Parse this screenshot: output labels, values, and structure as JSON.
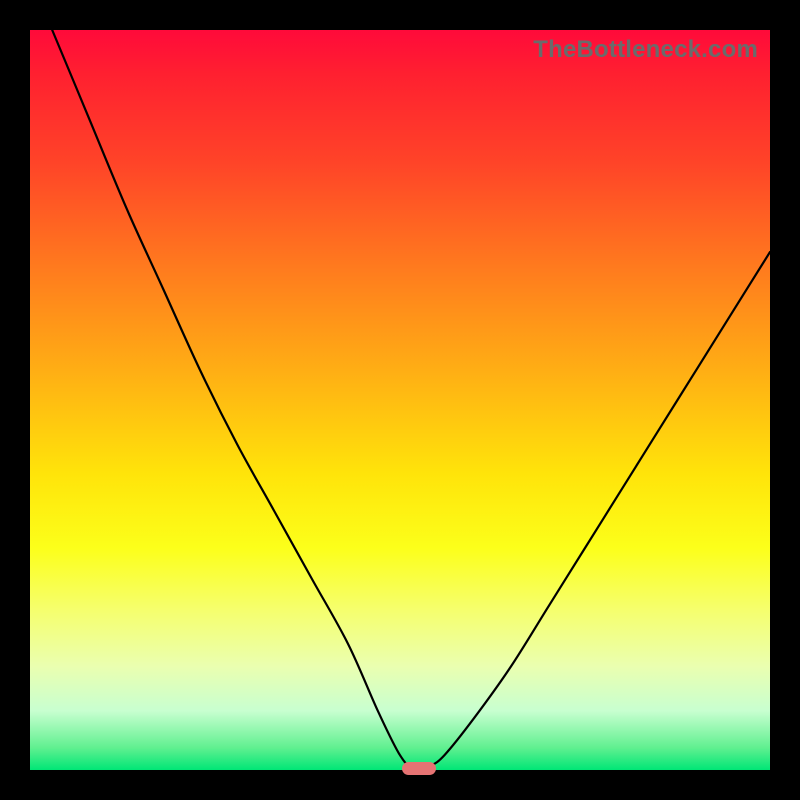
{
  "watermark": "TheBottleneck.com",
  "chart_data": {
    "type": "line",
    "title": "",
    "xlabel": "",
    "ylabel": "",
    "xlim": [
      0,
      100
    ],
    "ylim": [
      0,
      100
    ],
    "grid": false,
    "legend": false,
    "series": [
      {
        "name": "curve",
        "x": [
          3,
          8,
          13,
          18,
          23,
          28,
          33,
          38,
          43,
          47,
          50,
          52,
          54,
          56,
          60,
          65,
          70,
          75,
          80,
          85,
          90,
          95,
          100
        ],
        "y": [
          100,
          88,
          76,
          65,
          54,
          44,
          35,
          26,
          17,
          8,
          2,
          0,
          0.5,
          2,
          7,
          14,
          22,
          30,
          38,
          46,
          54,
          62,
          70
        ]
      }
    ],
    "marker": {
      "x": 52.5,
      "y": 0,
      "color": "#e57373"
    },
    "background_gradient": [
      "#ff0a3a",
      "#ffe40a",
      "#00e676"
    ]
  }
}
